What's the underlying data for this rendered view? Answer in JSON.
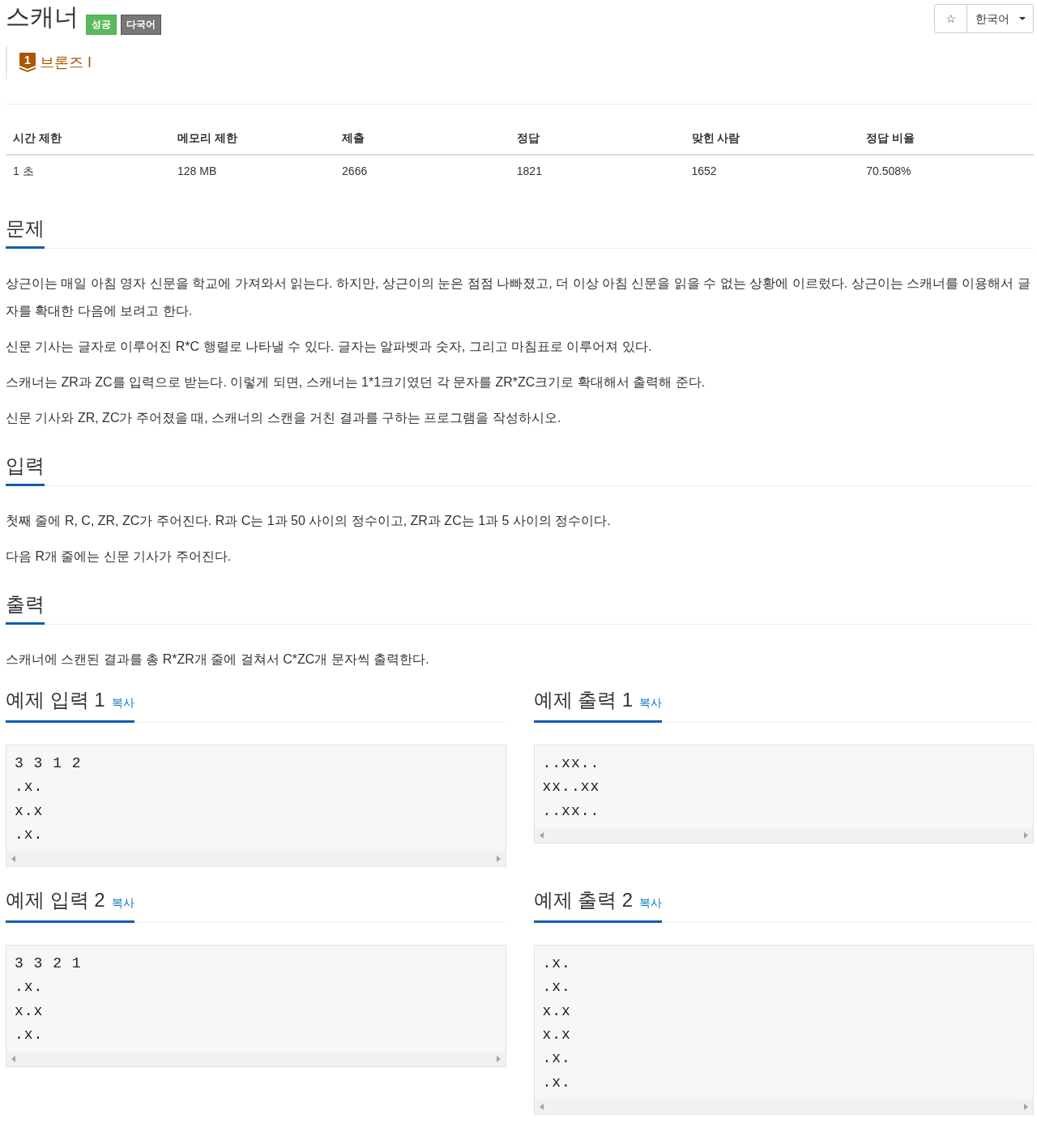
{
  "title": "스캐너",
  "badges": [
    {
      "label": "성공",
      "kind": "result"
    },
    {
      "label": "다국어",
      "kind": "language"
    }
  ],
  "toolbar": {
    "star": "☆",
    "language": "한국어"
  },
  "tier": {
    "number": "1",
    "label": "브론즈 I"
  },
  "stats": {
    "columns": [
      "시간 제한",
      "메모리 제한",
      "제출",
      "정답",
      "맞힌 사람",
      "정답 비율"
    ],
    "rows": [
      [
        "1 초",
        "128 MB",
        "2666",
        "1821",
        "1652",
        "70.508%"
      ]
    ]
  },
  "sections": [
    {
      "title": "문제",
      "paragraphs": [
        "상근이는 매일 아침 영자 신문을 학교에 가져와서 읽는다. 하지만, 상근이의 눈은 점점 나빠졌고, 더 이상 아침 신문을 읽을 수 없는 상황에 이르렀다. 상근이는 스캐너를 이용해서 글자를 확대한 다음에 보려고 한다.",
        "신문 기사는 글자로 이루어진 R*C 행렬로 나타낼 수 있다. 글자는 알파벳과 숫자, 그리고 마침표로 이루어져 있다.",
        "스캐너는 ZR과 ZC를 입력으로 받는다. 이렇게 되면, 스캐너는 1*1크기였던 각 문자를 ZR*ZC크기로 확대해서 출력해 준다.",
        "신문 기사와 ZR, ZC가 주어졌을 때, 스캐너의 스캔을 거친 결과를 구하는 프로그램을 작성하시오."
      ]
    },
    {
      "title": "입력",
      "paragraphs": [
        "첫째 줄에 R, C, ZR, ZC가 주어진다. R과 C는 1과 50 사이의 정수이고, ZR과 ZC는 1과 5 사이의 정수이다.",
        "다음 R개 줄에는 신문 기사가 주어진다."
      ]
    },
    {
      "title": "출력",
      "paragraphs": [
        "스캐너에 스캔된 결과를 총 R*ZR개 줄에 걸쳐서 C*ZC개 문자씩 출력한다."
      ]
    }
  ],
  "samples": [
    {
      "title": "예제 입력 1",
      "copy": "복사",
      "lines": [
        "3 3 1 2",
        ".x.",
        "x.x",
        ".x."
      ]
    },
    {
      "title": "예제 출력 1",
      "copy": "복사",
      "lines": [
        "..xx..",
        "xx..xx",
        "..xx.."
      ]
    },
    {
      "title": "예제 입력 2",
      "copy": "복사",
      "lines": [
        "3 3 2 1",
        ".x.",
        "x.x",
        ".x."
      ]
    },
    {
      "title": "예제 출력 2",
      "copy": "복사",
      "lines": [
        ".x.",
        ".x.",
        "x.x",
        "x.x",
        ".x.",
        ".x."
      ]
    }
  ]
}
